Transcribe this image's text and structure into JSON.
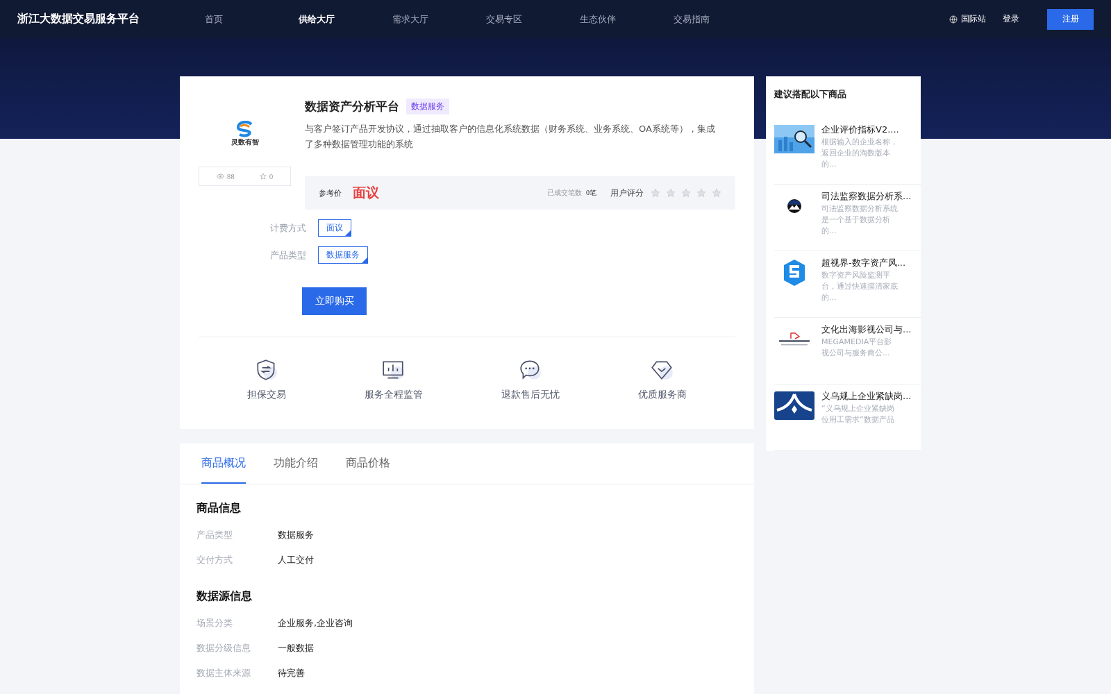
{
  "nav": {
    "brand": "浙江大数据交易服务平台",
    "items": [
      {
        "label": "首页",
        "selected": false
      },
      {
        "label": "供给大厅",
        "selected": true
      },
      {
        "label": "需求大厅",
        "selected": false
      },
      {
        "label": "交易专区",
        "selected": false
      },
      {
        "label": "生态伙伴",
        "selected": false
      },
      {
        "label": "交易指南",
        "selected": false
      }
    ],
    "intl": "国际站",
    "login": "登录",
    "register": "注册"
  },
  "product": {
    "logo_text": "灵数有智",
    "views": "88",
    "favorites": "0",
    "title": "数据资产分析平台",
    "tag": "数据服务",
    "description": "与客户签订产品开发协议，通过抽取客户的信息化系统数据（财务系统、业务系统、OA系统等），集成了多种数据管理功能的系统",
    "price_label": "参考价",
    "price": "面议",
    "deals_label": "已成交笔数",
    "deals": "0笔",
    "rating_label": "用户评分",
    "stars": 0,
    "fields": [
      {
        "label": "计费方式",
        "value": "面议"
      },
      {
        "label": "产品类型",
        "value": "数据服务"
      }
    ],
    "buy": "立即购买"
  },
  "features": [
    {
      "kind": "shield",
      "label": "担保交易"
    },
    {
      "kind": "monitor",
      "label": "服务全程监管"
    },
    {
      "kind": "chat",
      "label": "退款售后无忧"
    },
    {
      "kind": "diamond",
      "label": "优质服务商"
    }
  ],
  "tabs": [
    {
      "label": "商品概况",
      "selected": true
    },
    {
      "label": "功能介绍",
      "selected": false
    },
    {
      "label": "商品价格",
      "selected": false
    }
  ],
  "sections": [
    {
      "title": "商品信息",
      "rows": [
        {
          "label": "产品类型",
          "value": "数据服务"
        },
        {
          "label": "交付方式",
          "value": "人工交付"
        }
      ]
    },
    {
      "title": "数据源信息",
      "rows": [
        {
          "label": "场景分类",
          "value": "企业服务,企业咨询"
        },
        {
          "label": "数据分级信息",
          "value": "一般数据"
        },
        {
          "label": "数据主体来源",
          "value": "待完善"
        }
      ]
    }
  ],
  "recommend": {
    "title": "建议搭配以下商品",
    "items": [
      {
        "kind": "picture",
        "name": "企业评价指标V2....",
        "desc": "根据输入的企业名称，返回企业的淘数版本的..."
      },
      {
        "kind": "mountain",
        "name": "司法监察数据分析系...",
        "desc": "司法监察数据分析系统是一个基于数据分析的..."
      },
      {
        "kind": "shield",
        "name": "超视界-数字资产风...",
        "desc": "数字资产风险监测平台，通过快速摸清家底的..."
      },
      {
        "kind": "media",
        "name": "文化出海影视公司与...",
        "desc": "MEGAMEDIA平台影视公司与服务商公..."
      },
      {
        "kind": "emblem",
        "name": "义乌规上企业紧缺岗...",
        "desc": "“义乌规上企业紧缺岗位用工需求”数据产品"
      }
    ]
  }
}
